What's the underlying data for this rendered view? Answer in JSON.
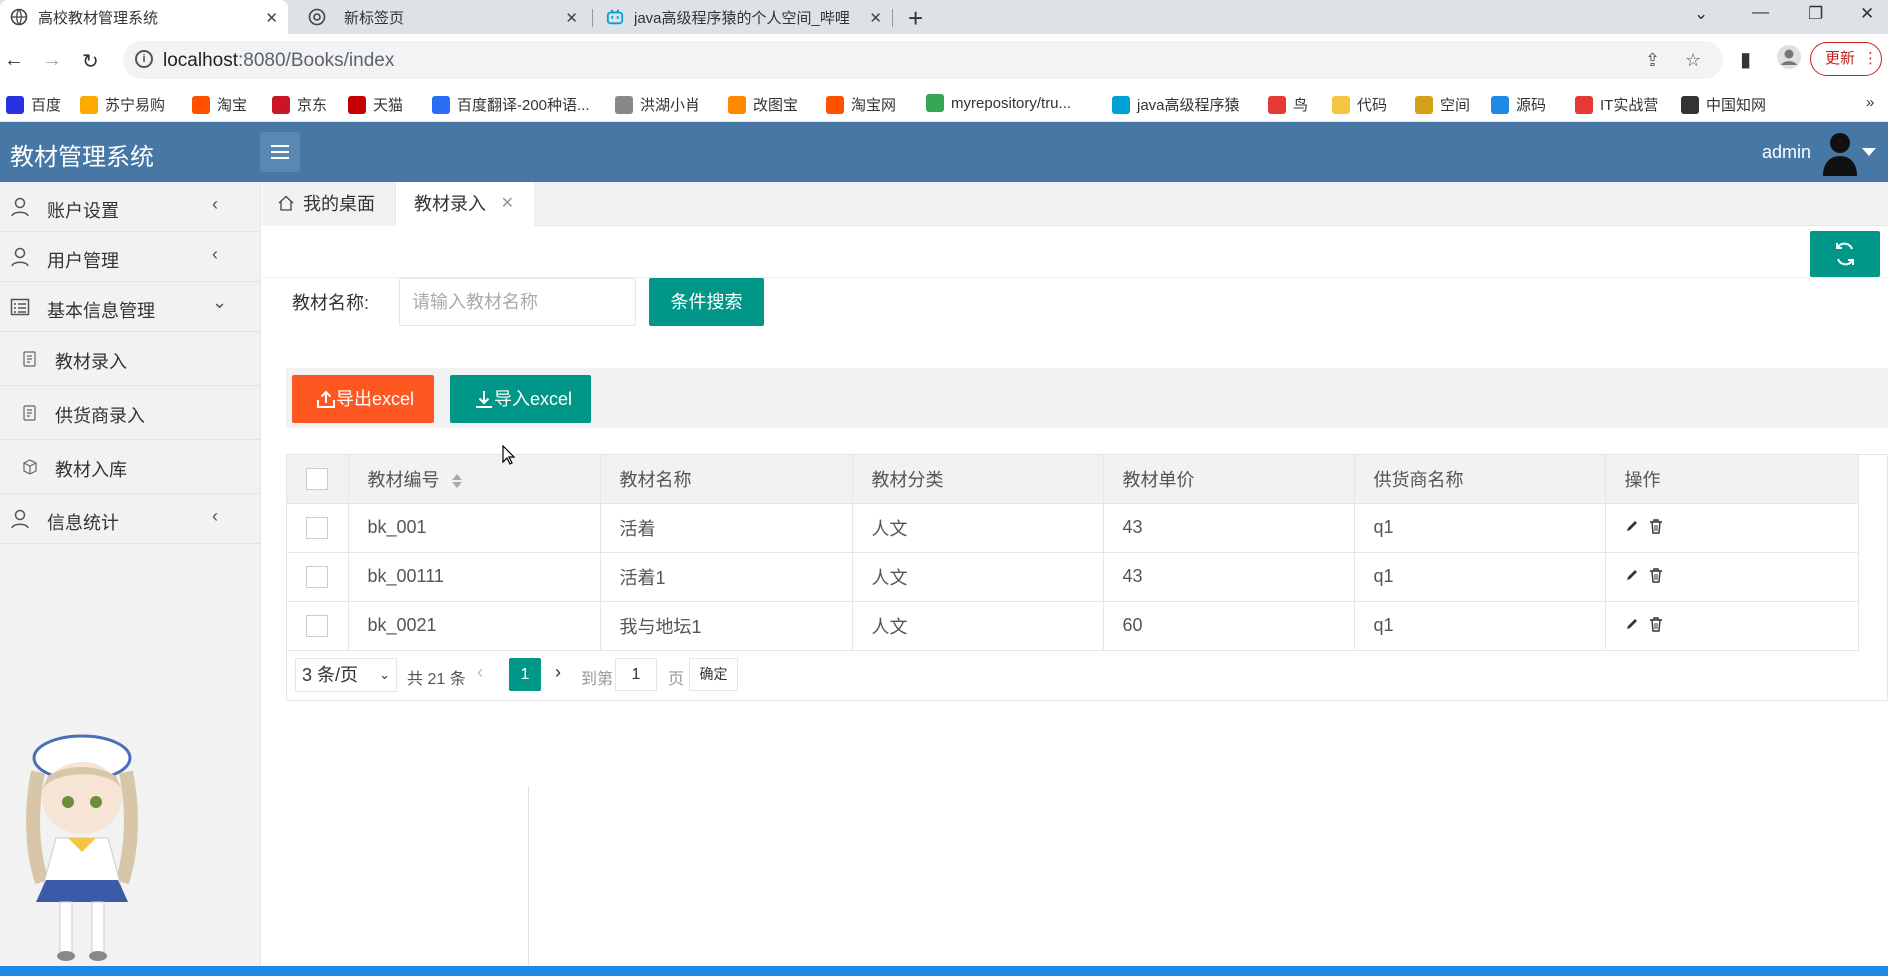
{
  "browser": {
    "tabs": [
      {
        "title": "高校教材管理系统",
        "active": true
      },
      {
        "title": "新标签页",
        "active": false
      },
      {
        "title": "java高级程序猿的个人空间_哔哩",
        "active": false
      }
    ],
    "url_host": "localhost",
    "url_rest": ":8080/Books/index",
    "update_label": "更新",
    "bookmarks": [
      {
        "label": "百度",
        "icon": "baidu-icon",
        "color": "#2932e1"
      },
      {
        "label": "苏宁易购",
        "icon": "suning-icon",
        "color": "#ffaa00"
      },
      {
        "label": "淘宝",
        "icon": "taobao-icon",
        "color": "#ff5000"
      },
      {
        "label": "京东",
        "icon": "jd-icon",
        "color": "#c91623"
      },
      {
        "label": "天猫",
        "icon": "tmall-icon",
        "color": "#c40000"
      },
      {
        "label": "百度翻译-200种语...",
        "icon": "translate-icon",
        "color": "#2b6ef6"
      },
      {
        "label": "洪湖小肖",
        "icon": "bird-icon",
        "color": "#888888"
      },
      {
        "label": "改图宝",
        "icon": "gaitubao-icon",
        "color": "#ff8800"
      },
      {
        "label": "淘宝网",
        "icon": "taobao-icon",
        "color": "#ff5000"
      },
      {
        "label": "myrepository/tru...",
        "icon": "chrome-icon",
        "color": "#34a853"
      },
      {
        "label": "java高级程序猿",
        "icon": "bilibili-icon",
        "color": "#00a1d6"
      },
      {
        "label": "鸟",
        "icon": "bird-icon",
        "color": "#e53935"
      },
      {
        "label": "代码",
        "icon": "code-icon",
        "color": "#f5c542"
      },
      {
        "label": "空间",
        "icon": "space-icon",
        "color": "#d4a017"
      },
      {
        "label": "源码",
        "icon": "source-icon",
        "color": "#1e88e5"
      },
      {
        "label": "IT实战营",
        "icon": "it-icon",
        "color": "#e53935"
      },
      {
        "label": "中国知网",
        "icon": "cnki-icon",
        "color": "#333333"
      }
    ]
  },
  "app": {
    "title": "教材管理系统",
    "user": "admin",
    "sidebar": {
      "items": [
        {
          "label": "账户设置"
        },
        {
          "label": "用户管理"
        },
        {
          "label": "基本信息管理"
        },
        {
          "label": "信息统计"
        }
      ],
      "subitems": [
        {
          "label": "教材录入"
        },
        {
          "label": "供货商录入"
        },
        {
          "label": "教材入库"
        }
      ]
    },
    "page_tabs": {
      "home": "我的桌面",
      "current": "教材录入"
    },
    "search": {
      "label": "教材名称:",
      "placeholder": "请输入教材名称",
      "button": "条件搜索"
    },
    "toolbar": {
      "export": "导出excel",
      "import": "导入excel"
    },
    "table": {
      "columns": [
        "教材编号",
        "教材名称",
        "教材分类",
        "教材单价",
        "供货商名称",
        "操作"
      ],
      "rows": [
        {
          "id": "bk_001",
          "name": "活着",
          "category": "人文",
          "price": "43",
          "supplier": "q1"
        },
        {
          "id": "bk_00111",
          "name": "活着1",
          "category": "人文",
          "price": "43",
          "supplier": "q1"
        },
        {
          "id": "bk_0021",
          "name": "我与地坛1",
          "category": "人文",
          "price": "60",
          "supplier": "q1"
        }
      ]
    },
    "pager": {
      "page_size": "3 条/页",
      "total": "共 21 条",
      "current": "1",
      "goto_label": "到第",
      "goto_value": "1",
      "page_unit": "页",
      "confirm": "确定"
    }
  }
}
